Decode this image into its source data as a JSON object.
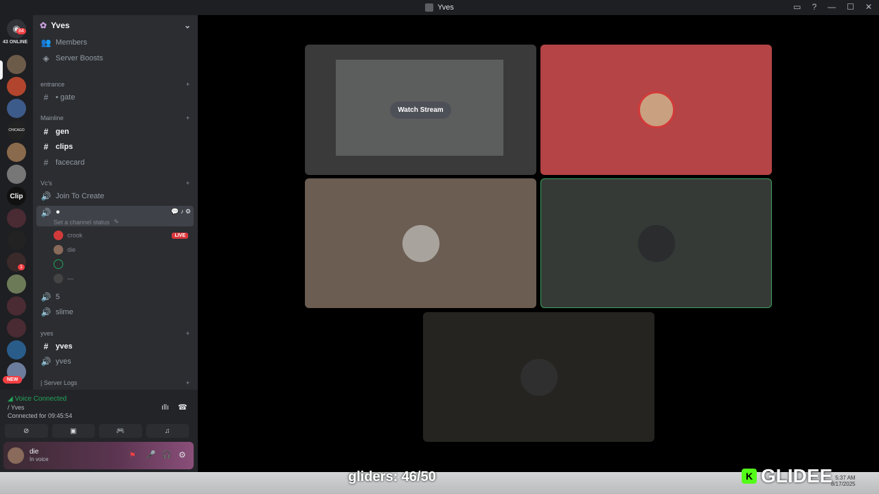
{
  "window": {
    "title": "Yves"
  },
  "guild_bar": {
    "online_badge": "84",
    "online_count": "43 ONLINE",
    "clip_label": "Clip",
    "mentions_badge": "1",
    "new_badge": "NEW"
  },
  "server": {
    "name": "Yves",
    "members": "Members",
    "boosts": "Server Boosts",
    "categories": {
      "entrance": "entrance",
      "mainline": "Mainline",
      "vcs": "Vc's",
      "yves": "yves",
      "logs": "| Server Logs"
    },
    "channels": {
      "gate": "• gate",
      "gen": "gen",
      "clips": "clips",
      "facecard": "facecard",
      "join": "Join To Create",
      "vc_status": "Set a channel status",
      "v5": "5",
      "slime": "slime",
      "yves_text": "yves",
      "yves_voice": "yves"
    },
    "voice_users": [
      {
        "name": "crook",
        "live": "LIVE"
      },
      {
        "name": "die"
      },
      {
        "name": ""
      },
      {
        "name": "—"
      }
    ]
  },
  "voice_panel": {
    "status": "Voice Connected",
    "channel": "/ Yves",
    "connected_for": "Connected for 09:45:54"
  },
  "user": {
    "name": "die",
    "status": "In voice"
  },
  "stage": {
    "watch_stream": "Watch Stream"
  },
  "overlay": {
    "counter": "gliders: 46/50",
    "brand": "GLIDEE"
  },
  "clock": {
    "time": "5:37 AM",
    "date": "8/17/2025"
  }
}
